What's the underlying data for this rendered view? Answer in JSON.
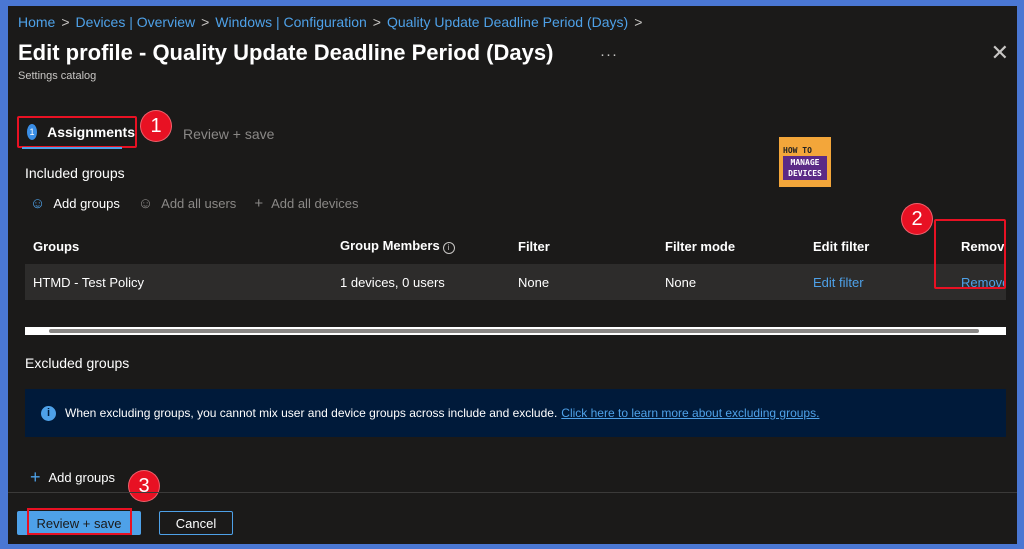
{
  "breadcrumb": [
    "Home",
    "Devices | Overview",
    "Windows | Configuration",
    "Quality Update Deadline Period (Days)"
  ],
  "header": {
    "title": "Edit profile - Quality Update Deadline Period (Days)",
    "subtitle": "Settings catalog",
    "more": "···",
    "close": "✕"
  },
  "steps": [
    {
      "number": "1",
      "label": "Assignments",
      "active": true
    },
    {
      "label": "Review + save",
      "active": false
    }
  ],
  "callouts": [
    "1",
    "2",
    "3"
  ],
  "logo": {
    "line1": "HOW TO",
    "line2": "MANAGE",
    "line3": "DEVICES"
  },
  "included": {
    "label": "Included groups",
    "toolbar": [
      {
        "label": "Add groups",
        "icon": "add-user-icon",
        "enabled": true
      },
      {
        "label": "Add all users",
        "icon": "users-icon",
        "enabled": false
      },
      {
        "label": "Add all devices",
        "icon": "plus-icon",
        "enabled": false
      }
    ],
    "columns": [
      "Groups",
      "Group Members",
      "Filter",
      "Filter mode",
      "Edit filter",
      "Remove"
    ],
    "rows": [
      {
        "group": "HTMD - Test Policy",
        "members": "1 devices, 0 users",
        "filter": "None",
        "filter_mode": "None",
        "edit_filter": "Edit filter",
        "remove": "Remove"
      }
    ]
  },
  "excluded": {
    "label": "Excluded groups",
    "banner_text": "When excluding groups, you cannot mix user and device groups across include and exclude.",
    "banner_link": "Click here to learn more about excluding groups.",
    "add_label": "Add groups"
  },
  "footer": {
    "primary": "Review + save",
    "secondary": "Cancel"
  },
  "colors": {
    "accent": "#4ea1e8",
    "highlight": "#e81123",
    "background": "#1b1a19"
  }
}
